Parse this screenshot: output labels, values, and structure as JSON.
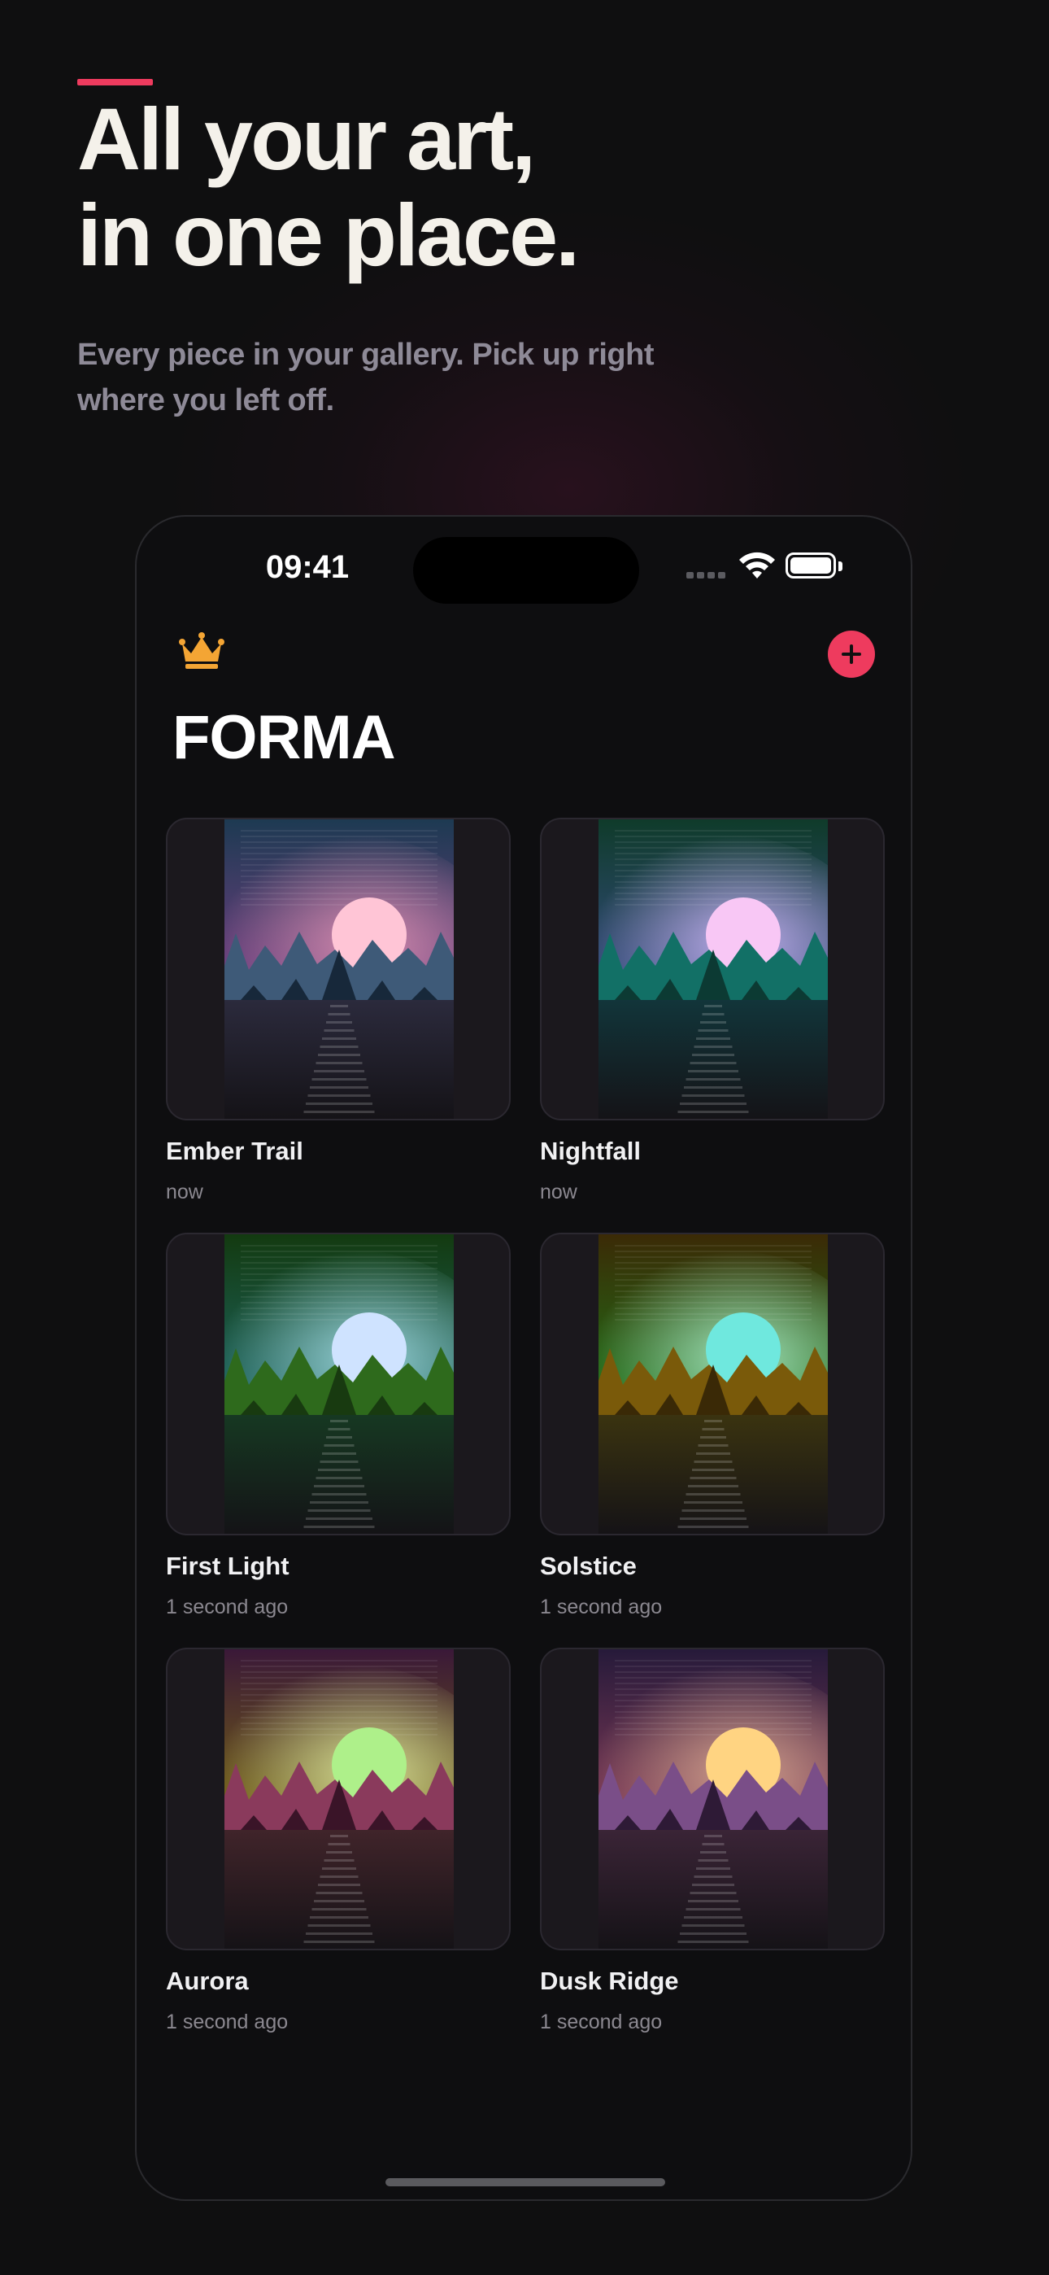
{
  "marketing": {
    "headline_line1": "All your art,",
    "headline_line2": "in one place.",
    "subhead_line1": "Every piece in your gallery. Pick up right",
    "subhead_line2": "where you left off.",
    "accent_color": "#ee3b5e"
  },
  "status_bar": {
    "time": "09:41"
  },
  "app": {
    "title": "FORMA",
    "premium_icon": "crown-icon",
    "add_icon": "plus-icon",
    "accent_color": "#ee3b5e",
    "crown_color": "#f4a534"
  },
  "gallery": [
    {
      "title": "Ember Trail",
      "time": "now",
      "sky_top": "#1d3a52",
      "sky_mid": "#7a3f86",
      "glow": "#d98fb0",
      "sun": "#ffc5d6",
      "trees": "#3e5a78",
      "trees_front": "#17283a",
      "ground": "#2b2a3c"
    },
    {
      "title": "Nightfall",
      "time": "now",
      "sky_top": "#0f3b2a",
      "sky_mid": "#3a4e8a",
      "glow": "#c7b3f2",
      "sun": "#f8c7f5",
      "trees": "#127066",
      "trees_front": "#0c3a33",
      "ground": "#12353a"
    },
    {
      "title": "First Light",
      "time": "1 second ago",
      "sky_top": "#133a10",
      "sky_mid": "#1f6b6a",
      "glow": "#9ed7de",
      "sun": "#cfe3ff",
      "trees": "#2e6a1c",
      "trees_front": "#183a10",
      "ground": "#163822"
    },
    {
      "title": "Solstice",
      "time": "1 second ago",
      "sky_top": "#3b2a06",
      "sky_mid": "#1c7a1a",
      "glow": "#a6e8c2",
      "sun": "#6fe8de",
      "trees": "#7a5a0a",
      "trees_front": "#3a2906",
      "ground": "#3a3310"
    },
    {
      "title": "Aurora",
      "time": "1 second ago",
      "sky_top": "#3a1838",
      "sky_mid": "#7a6a10",
      "glow": "#d9e39a",
      "sun": "#aef08a",
      "trees": "#8a3a5c",
      "trees_front": "#3a1428",
      "ground": "#40242a"
    },
    {
      "title": "Dusk Ridge",
      "time": "1 second ago",
      "sky_top": "#261a3a",
      "sky_mid": "#8a3e5a",
      "glow": "#d5a58e",
      "sun": "#ffd482",
      "trees": "#7a4e88",
      "trees_front": "#2e1a36",
      "ground": "#3a2436"
    }
  ]
}
